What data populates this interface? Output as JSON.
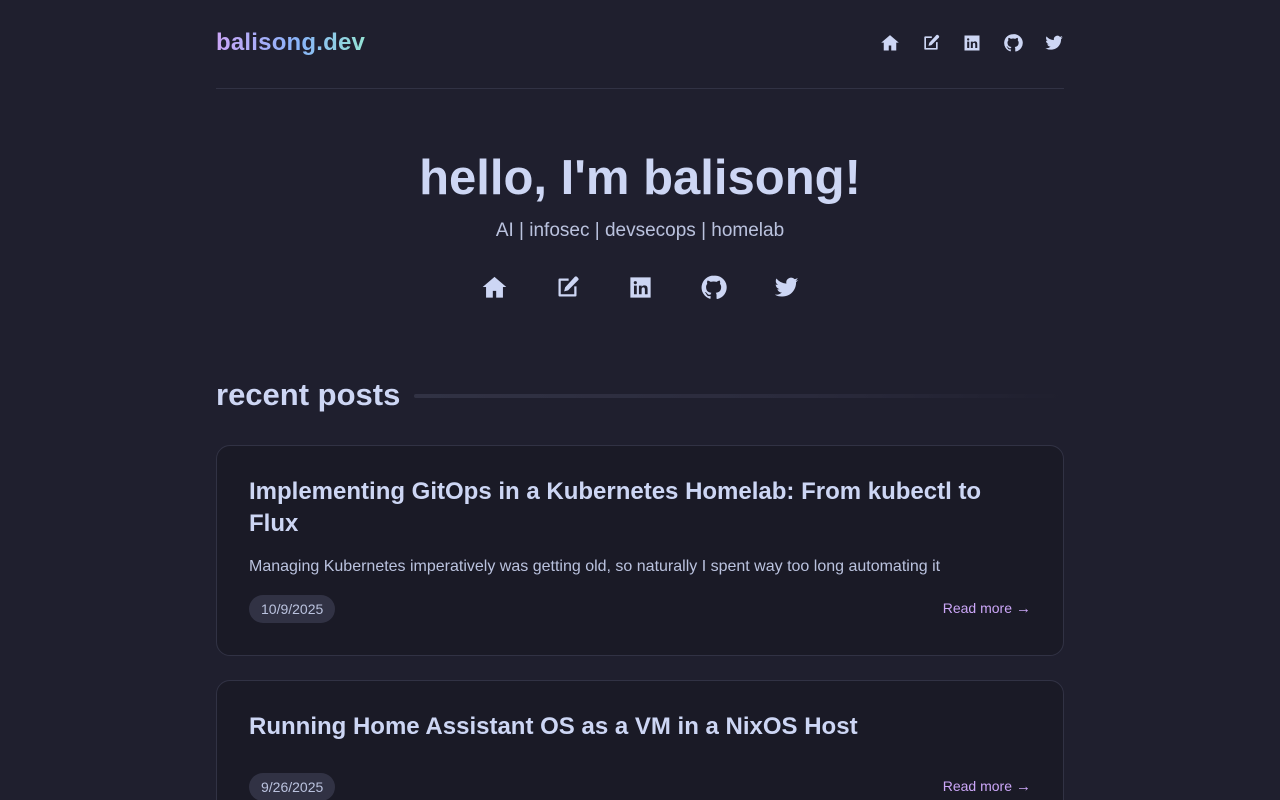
{
  "site": {
    "logo": "balisong.dev"
  },
  "nav": [
    {
      "icon": "home-icon"
    },
    {
      "icon": "edit-icon"
    },
    {
      "icon": "linkedin-icon"
    },
    {
      "icon": "github-icon"
    },
    {
      "icon": "twitter-icon"
    }
  ],
  "hero": {
    "title": "hello, I'm balisong!",
    "tagline": "AI | infosec | devsecops | homelab"
  },
  "section": {
    "title": "recent posts"
  },
  "posts": [
    {
      "title": "Implementing GitOps in a Kubernetes Homelab: From kubectl to Flux",
      "description": "Managing Kubernetes imperatively was getting old, so naturally I spent way too long automating it",
      "date": "10/9/2025",
      "read_more": "Read more",
      "arrow": "→"
    },
    {
      "title": "Running Home Assistant OS as a VM in a NixOS Host",
      "description": "",
      "date": "9/26/2025",
      "read_more": "Read more",
      "arrow": "→"
    }
  ],
  "colors": {
    "background": "#1f1f2e",
    "card": "#1a1a26",
    "text": "#cdd6f4",
    "accent": "#cba6f7",
    "border": "#313244"
  }
}
